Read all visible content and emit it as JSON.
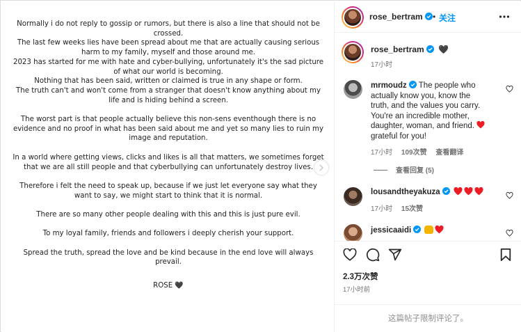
{
  "post": {
    "paragraphs": [
      [
        "Normally i do not reply to gossip or rumors, but there is also a line that should not be crossed.",
        "The last few weeks lies have been spread about me that are actually causing serious harm to my family, myself and those around me.",
        "2023 has started for me with hate and cyber-bullying, unfortunately it's the sad picture of what our world is becoming.",
        "Nothing that has been said, written or claimed is true in any shape or form.",
        "The truth can't and won't come from a stranger that doesn't know anything about my life and is hiding behind a screen."
      ],
      [
        "The worst part is that people actually believe this non-sens eventhough there is no evidence and no proof in what has been said about me and yet so many lies to ruin my image and reputation."
      ],
      [
        "In a world where getting views, clicks and likes is all that matters, we sometimes forget that we are all still people and that cyberbullying can unfortunately destroy lives."
      ],
      [
        "Therefore i felt the need to speak up, because if we just let everyone say what they want to say, we might start to think that it is normal."
      ],
      [
        "There are so many other people dealing with this and this is just pure evil."
      ],
      [
        "To my loyal family, friends and followers i deeply cherish your support."
      ],
      [
        "Spread the truth, spread the love and be kind because in the end love will always prevail."
      ]
    ],
    "signature": "ROSE",
    "signature_emoji": "🖤"
  },
  "header": {
    "username": "rose_bertram",
    "separator": "•",
    "follow_label": "关注"
  },
  "caption": {
    "username": "rose_bertram",
    "emoji": "🖤",
    "time": "17小时"
  },
  "comments": [
    {
      "username": "mrmoudz",
      "text": "The people who actually know you, know the truth, and the values you carry. You're an incredible mother, daughter, woman, and friend. ❤️ grateful for you!",
      "text_lines": [
        "The people who",
        "actually know you, know the",
        "truth, and the values you carry.",
        "You're an incredible mother,",
        "daughter, woman, and friend.",
        "grateful for you!"
      ],
      "time": "17小时",
      "likes": "109次赞",
      "translate": "查看翻译",
      "replies": "查看回复 (5)"
    },
    {
      "username": "lousandtheyakuza",
      "text": "❤️❤️❤️",
      "time": "17小时",
      "likes": "15次赞"
    },
    {
      "username": "jessicaaidi",
      "text": "🙌❤️"
    }
  ],
  "stats": {
    "likes": "2.3万次赞",
    "time": "17小时前",
    "comments_disabled": "这篇帖子限制评论了。"
  },
  "colors": {
    "accent": "#0095f6",
    "verified": "#0095f6",
    "heart": "#ed1c24",
    "muted": "#737373"
  },
  "icons": [
    "verified-badge-icon",
    "more-options-icon",
    "heart-outline-icon",
    "comment-icon",
    "share-icon",
    "bookmark-icon",
    "black-heart-icon",
    "red-heart-icon",
    "raised-hands-icon",
    "chevron-right-icon"
  ]
}
